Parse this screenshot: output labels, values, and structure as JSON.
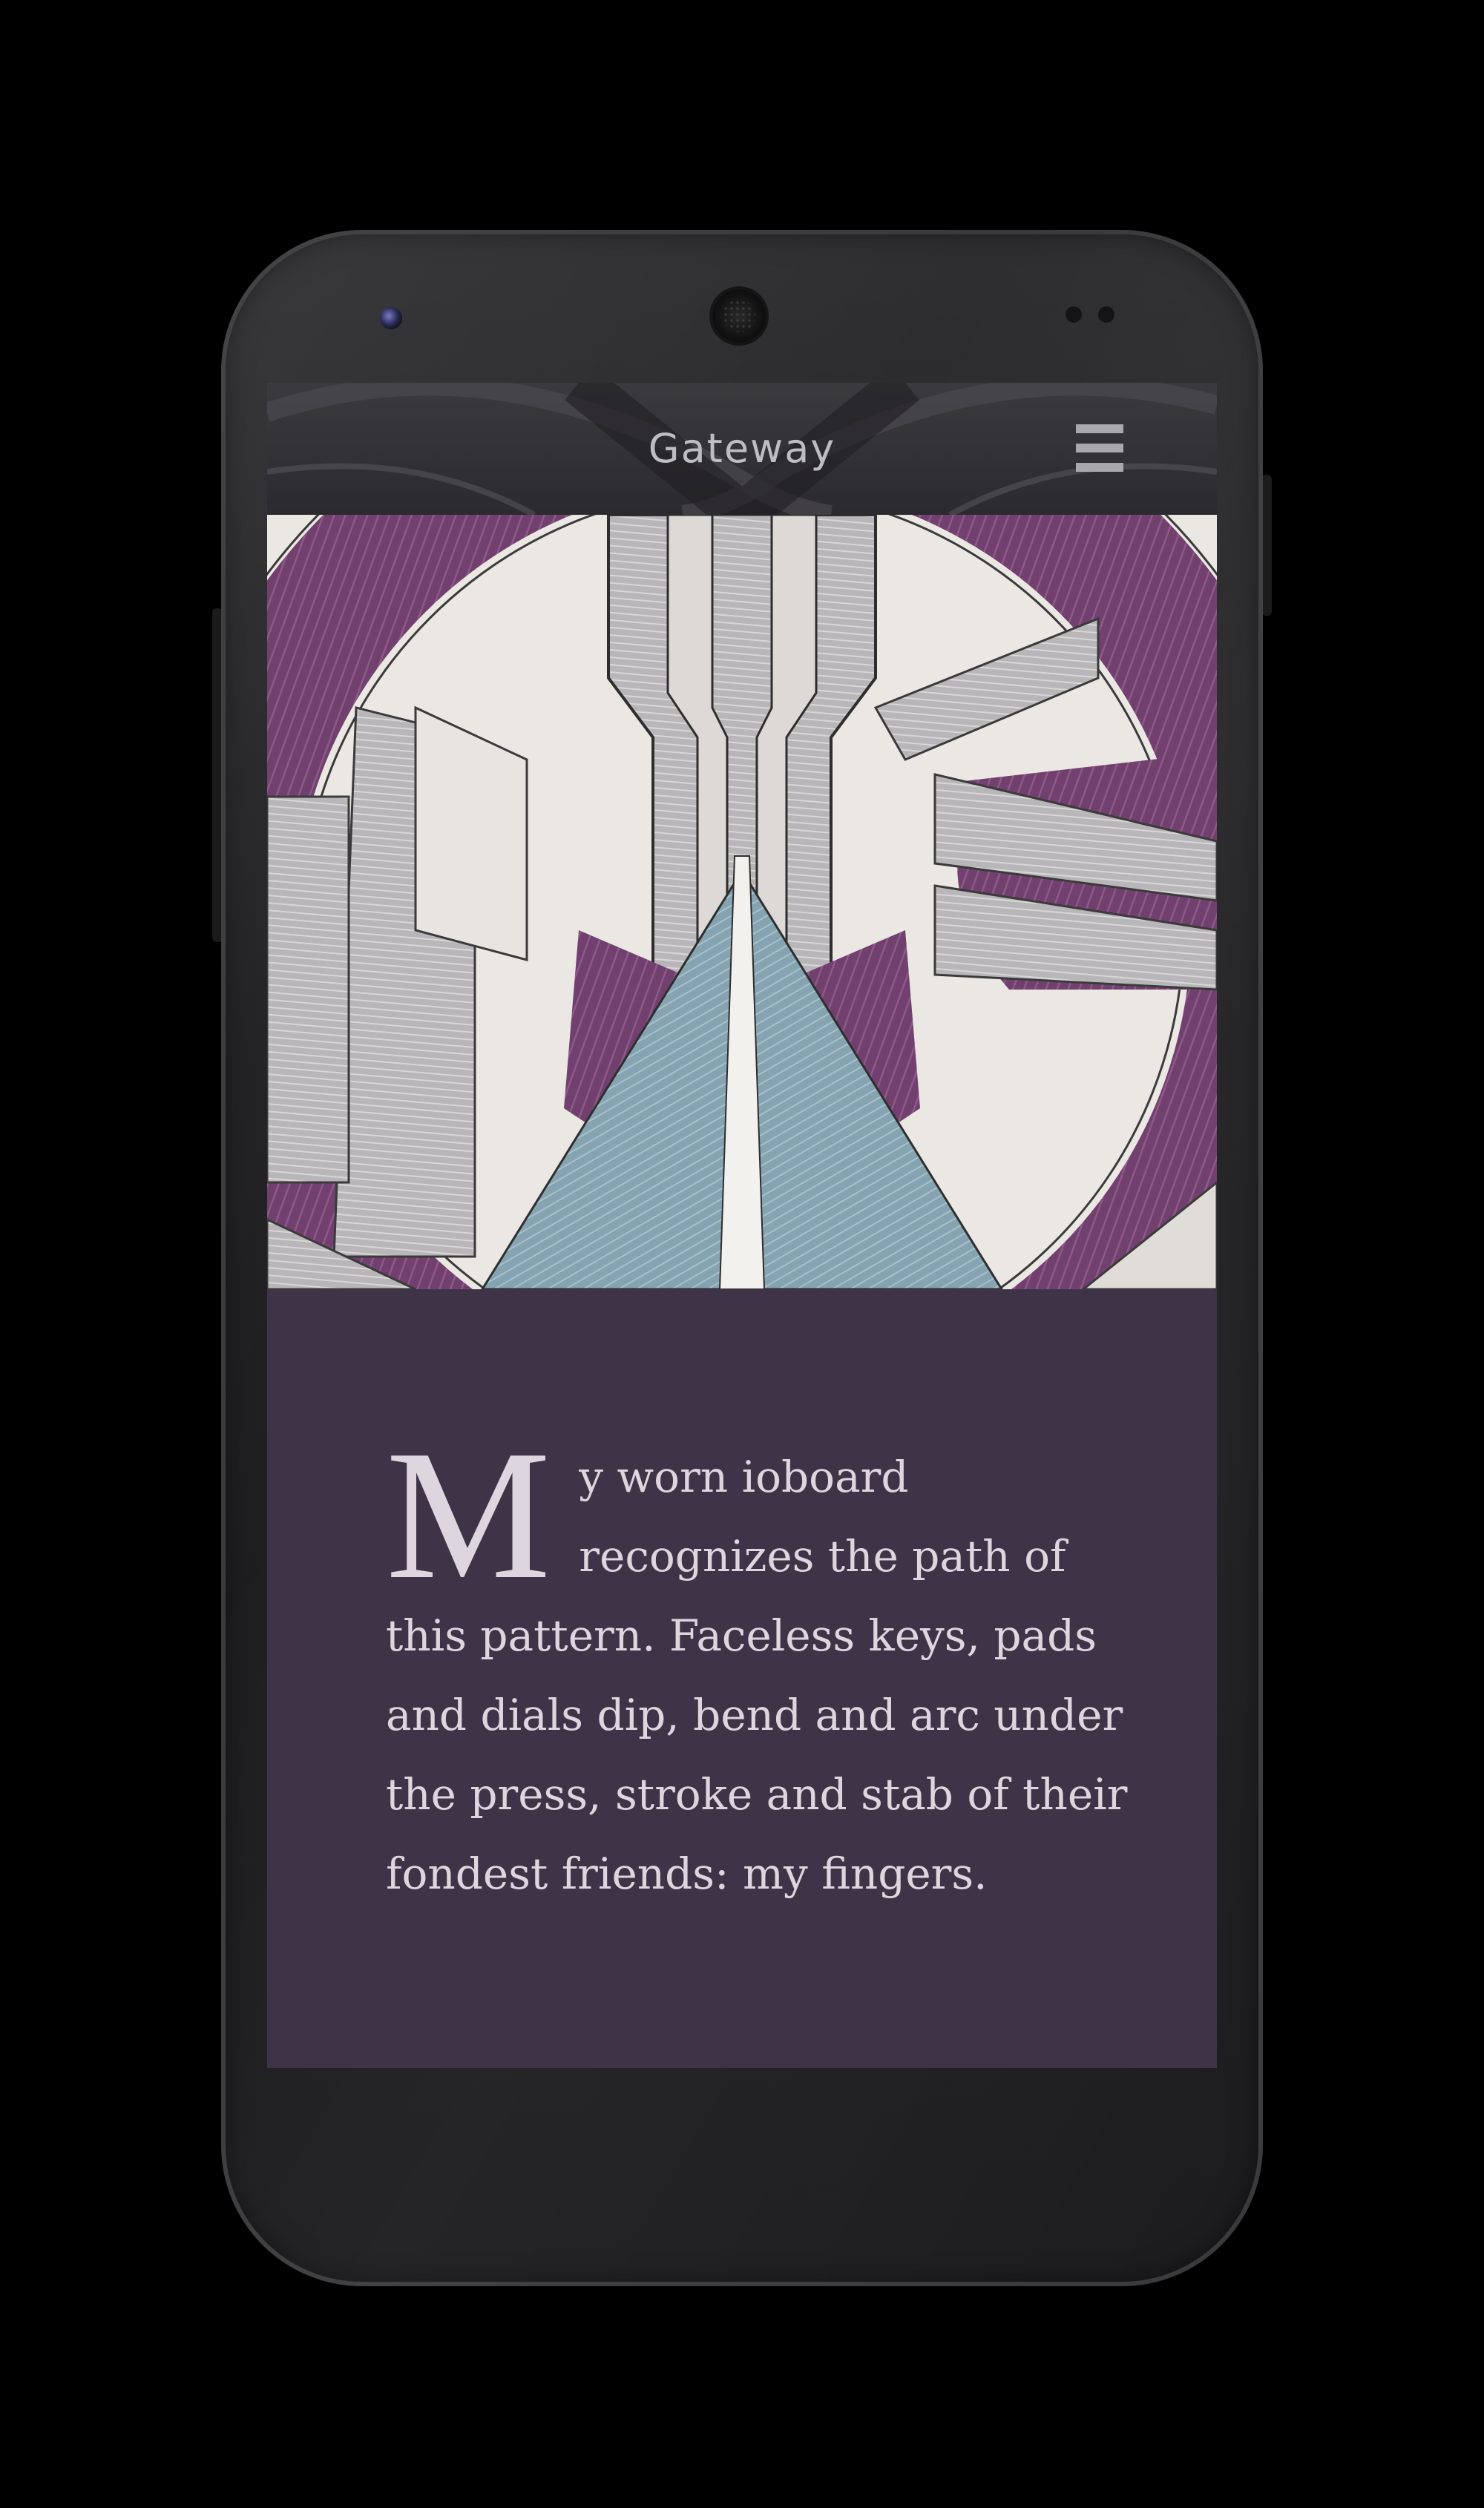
{
  "app": {
    "title": "Gateway"
  },
  "menu": {
    "icon": "hamburger-menu-icon"
  },
  "hero": {
    "icon": "gateway-artwork-image"
  },
  "article": {
    "drop_cap": "M",
    "text": "y worn ioboard recognizes the path of this pattern. Faceless keys, pads and dials dip, bend and arc under the press, stroke and stab of their fondest friends: my fingers."
  },
  "colors": {
    "background": "#000000",
    "phone_body": "#202022",
    "app_bar": "#2b2a2e",
    "content_background": "#3f3447",
    "text": "#ddd6df",
    "art_purple": "#6e3a6e",
    "art_blue": "#8aa7b5"
  }
}
